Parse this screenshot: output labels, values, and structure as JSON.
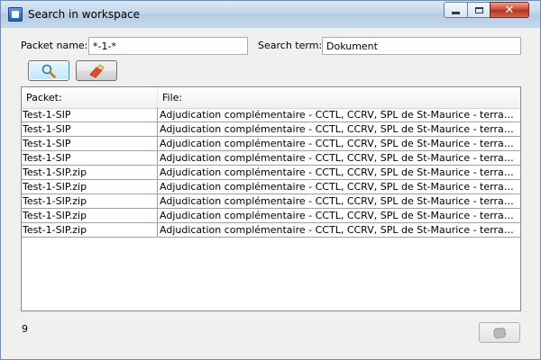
{
  "window": {
    "title": "Search in workspace",
    "icon": "app-icon"
  },
  "form": {
    "packet_label": "Packet name:",
    "packet_value": "*-1-*",
    "term_label": "Search term:",
    "term_value": "Dokument"
  },
  "toolbar": {
    "search_icon": "magnifier-icon",
    "clear_icon": "eraser-icon"
  },
  "table": {
    "headers": [
      "Packet:",
      "File:"
    ],
    "rows": [
      [
        "Test-1-SIP",
        "Adjudication complémentaire - CCTL, CCRV, SPL de St-Maurice - terrassements ..."
      ],
      [
        "Test-1-SIP",
        "Adjudication complémentaire - CCTL, CCRV, SPL de St-Maurice - terrassements ..."
      ],
      [
        "Test-1-SIP",
        "Adjudication complémentaire - CCTL, CCRV, SPL de St-Maurice - terrassements ..."
      ],
      [
        "Test-1-SIP",
        "Adjudication complémentaire - CCTL, CCRV, SPL de St-Maurice - terrassements ..."
      ],
      [
        "Test-1-SIP.zip",
        "Adjudication complémentaire - CCTL, CCRV, SPL de St-Maurice - terrassements ..."
      ],
      [
        "Test-1-SIP.zip",
        "Adjudication complémentaire - CCTL, CCRV, SPL de St-Maurice - terrassements ..."
      ],
      [
        "Test-1-SIP.zip",
        "Adjudication complémentaire - CCTL, CCRV, SPL de St-Maurice - terrassements ..."
      ],
      [
        "Test-1-SIP.zip",
        "Adjudication complémentaire - CCTL, CCRV, SPL de St-Maurice - terrassements ..."
      ],
      [
        "Test-1-SIP.zip",
        "Adjudication complémentaire - CCTL, CCRV, SPL de St-Maurice - terrassements ..."
      ]
    ]
  },
  "status": {
    "count": "9"
  },
  "colors": {
    "accent": "#3c7fb1",
    "close_red": "#c7452f"
  }
}
